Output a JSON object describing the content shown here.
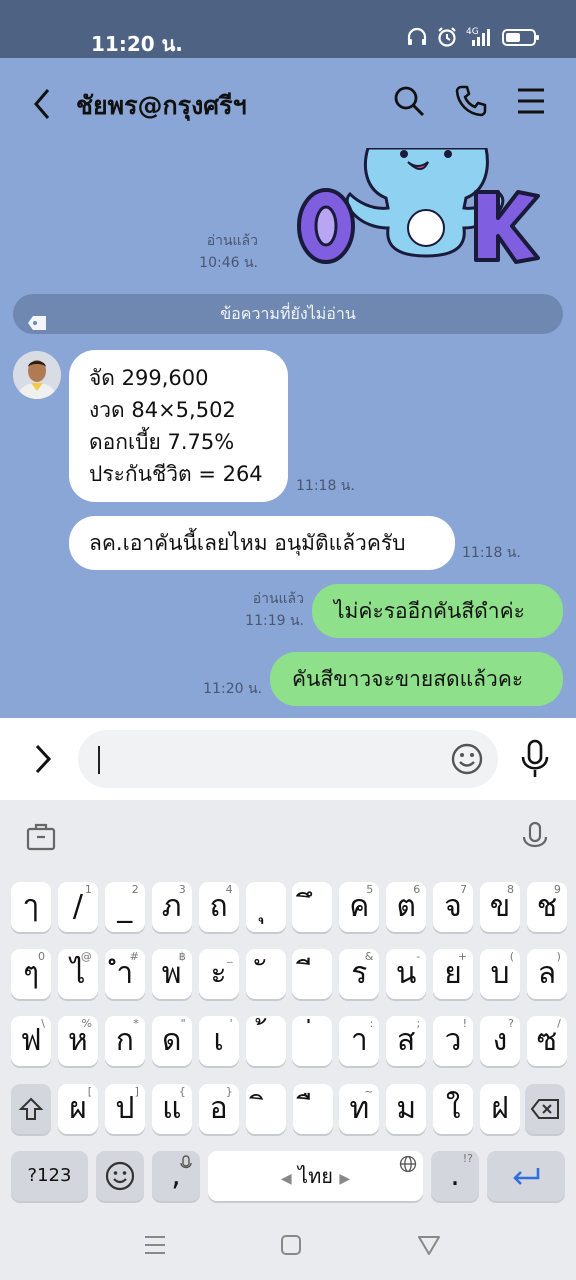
{
  "status_bar": {
    "time": "11:20 น.",
    "icons": [
      "headphones-icon",
      "alarm-icon",
      "4g-signal-icon",
      "battery-icon"
    ],
    "network_label": "4G"
  },
  "header": {
    "title": "ชัยพร@กรุงศรีฯ",
    "buttons": [
      "back-icon",
      "search-icon",
      "phone-icon",
      "menu-icon"
    ]
  },
  "chat": {
    "sticker_text": "OK",
    "sticker_meta": {
      "read": "อ่านแล้ว",
      "time": "10:46 น."
    },
    "unread_divider": "ข้อความที่ยังไม่อ่าน",
    "messages": [
      {
        "side": "in",
        "lines": [
          "จัด 299,600",
          "งวด 84×5,502",
          "ดอกเบี้ย 7.75%",
          "ประกันชีวิต = 264"
        ],
        "time": "11:18 น."
      },
      {
        "side": "in",
        "lines": [
          "ลค.เอาคันนี้เลยไหม อนุมัติแล้วครับ"
        ],
        "time": "11:18 น."
      },
      {
        "side": "out",
        "lines": [
          "ไม่ค่ะรออีกคันสีดำค่ะ"
        ],
        "read": "อ่านแล้ว",
        "time": "11:19 น."
      },
      {
        "side": "out",
        "lines": [
          "คันสีขาวจะขายสดแล้วคะ"
        ],
        "time": "11:20 น."
      }
    ]
  },
  "input": {
    "placeholder": "",
    "value": ""
  },
  "keyboard": {
    "language_label": "ไทย",
    "symbols_label": "?123",
    "comma": ",",
    "period": ".",
    "period_hint": "!?",
    "rows": [
      [
        {
          "k": "ๅ",
          "h": ""
        },
        {
          "k": "/",
          "h": "1"
        },
        {
          "k": "_",
          "h": "2"
        },
        {
          "k": "ภ",
          "h": "3"
        },
        {
          "k": "ถ",
          "h": "4"
        },
        {
          "k": "ุ",
          "h": ""
        },
        {
          "k": "ึ",
          "h": ""
        },
        {
          "k": "ค",
          "h": "5"
        },
        {
          "k": "ต",
          "h": "6"
        },
        {
          "k": "จ",
          "h": "7"
        },
        {
          "k": "ข",
          "h": "8"
        },
        {
          "k": "ช",
          "h": "9"
        }
      ],
      [
        {
          "k": "ๆ",
          "h": "0"
        },
        {
          "k": "ไ",
          "h": "@"
        },
        {
          "k": "ำ",
          "h": "#"
        },
        {
          "k": "พ",
          "h": "฿"
        },
        {
          "k": "ะ",
          "h": "_"
        },
        {
          "k": "ั",
          "h": ""
        },
        {
          "k": "ี",
          "h": ""
        },
        {
          "k": "ร",
          "h": "&"
        },
        {
          "k": "น",
          "h": "-"
        },
        {
          "k": "ย",
          "h": "+"
        },
        {
          "k": "บ",
          "h": "("
        },
        {
          "k": "ล",
          "h": ")"
        }
      ],
      [
        {
          "k": "ฟ",
          "h": "\\"
        },
        {
          "k": "ห",
          "h": "%"
        },
        {
          "k": "ก",
          "h": "*"
        },
        {
          "k": "ด",
          "h": "\""
        },
        {
          "k": "เ",
          "h": "'"
        },
        {
          "k": "้",
          "h": ""
        },
        {
          "k": "่",
          "h": ""
        },
        {
          "k": "า",
          "h": ":"
        },
        {
          "k": "ส",
          "h": ";"
        },
        {
          "k": "ว",
          "h": "!"
        },
        {
          "k": "ง",
          "h": "?"
        },
        {
          "k": "ซ",
          "h": "/"
        }
      ],
      [
        {
          "k": "ผ",
          "h": "["
        },
        {
          "k": "ป",
          "h": "]"
        },
        {
          "k": "แ",
          "h": "{"
        },
        {
          "k": "อ",
          "h": "}"
        },
        {
          "k": "ิ",
          "h": ""
        },
        {
          "k": "ื",
          "h": ""
        },
        {
          "k": "ท",
          "h": "~"
        },
        {
          "k": "ม",
          "h": ""
        },
        {
          "k": "ใ",
          "h": ""
        },
        {
          "k": "ฝ",
          "h": ""
        }
      ]
    ]
  },
  "colors": {
    "chat_bg": "#8aa6d6",
    "status_bg": "#4e6283",
    "bubble_in": "#ffffff",
    "bubble_out": "#8ee08a",
    "enter_arrow": "#2f6fe0"
  }
}
